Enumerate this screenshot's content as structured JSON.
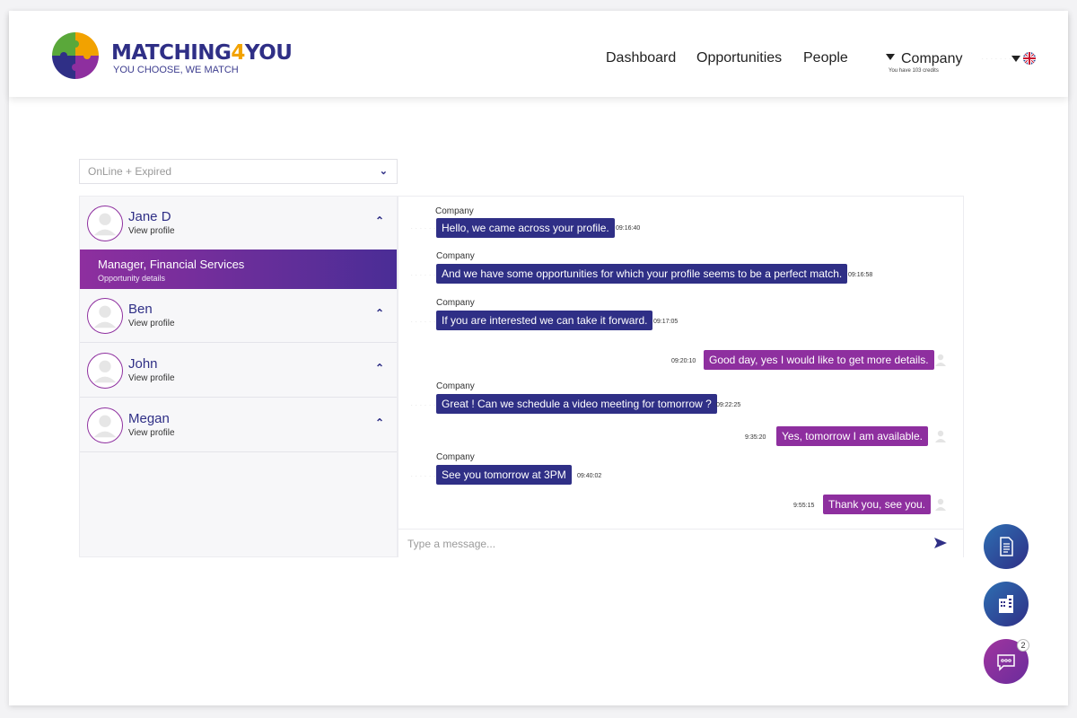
{
  "brand": {
    "name_part1": "MATCHING",
    "name_part2": "4",
    "name_part3": "YOU",
    "tagline": "YOU CHOOSE, WE MATCH"
  },
  "nav": {
    "items": [
      "Dashboard",
      "Opportunities",
      "People"
    ]
  },
  "account": {
    "company": "Company",
    "credits": "You have 103 credits"
  },
  "filter": {
    "selected": "OnLine + Expired"
  },
  "contacts": [
    {
      "name": "Jane D",
      "link": "View profile",
      "expanded": true
    },
    {
      "name": "Ben",
      "link": "View profile"
    },
    {
      "name": "John",
      "link": "View profile"
    },
    {
      "name": "Megan",
      "link": "View profile"
    }
  ],
  "opportunity": {
    "title": "Manager, Financial Services",
    "link": "Opportunity details"
  },
  "messages": [
    {
      "direction": "in",
      "sender": "Company",
      "text": "Hello, we came across your profile.",
      "time": "09:16:40"
    },
    {
      "direction": "in",
      "sender": "Company",
      "text": "And we have some opportunities for which your profile seems to be a perfect match.",
      "time": "09:16:58"
    },
    {
      "direction": "in",
      "sender": "Company",
      "text": "If you are interested we can take it forward.",
      "time": "09:17:05"
    },
    {
      "direction": "out",
      "text": "Good day, yes I would like to get more details.",
      "time": "09:20:10"
    },
    {
      "direction": "in",
      "sender": "Company",
      "text": "Great ! Can we schedule a video meeting for tomorrow ?",
      "time": "09:22:25"
    },
    {
      "direction": "out",
      "text": "Yes, tomorrow I am available.",
      "time": "9:35:20"
    },
    {
      "direction": "in",
      "sender": "Company",
      "text": "See you tomorrow at 3PM",
      "time": "09:40:02"
    },
    {
      "direction": "out",
      "text": "Thank you, see you.",
      "time": "9:55:15"
    }
  ],
  "composer": {
    "placeholder": "Type a message..."
  },
  "fabs": {
    "chat_badge": "2"
  },
  "colors": {
    "primary": "#2f2f86",
    "secondary": "#8e2f9f",
    "accent": "#f2a200"
  },
  "icons": [
    "puzzle-logo-icon",
    "caret-down-icon",
    "uk-flag-icon",
    "chevron-down-icon",
    "chevron-up-icon",
    "user-avatar-icon",
    "send-icon",
    "document-icon",
    "building-icon",
    "chat-bubble-icon"
  ]
}
